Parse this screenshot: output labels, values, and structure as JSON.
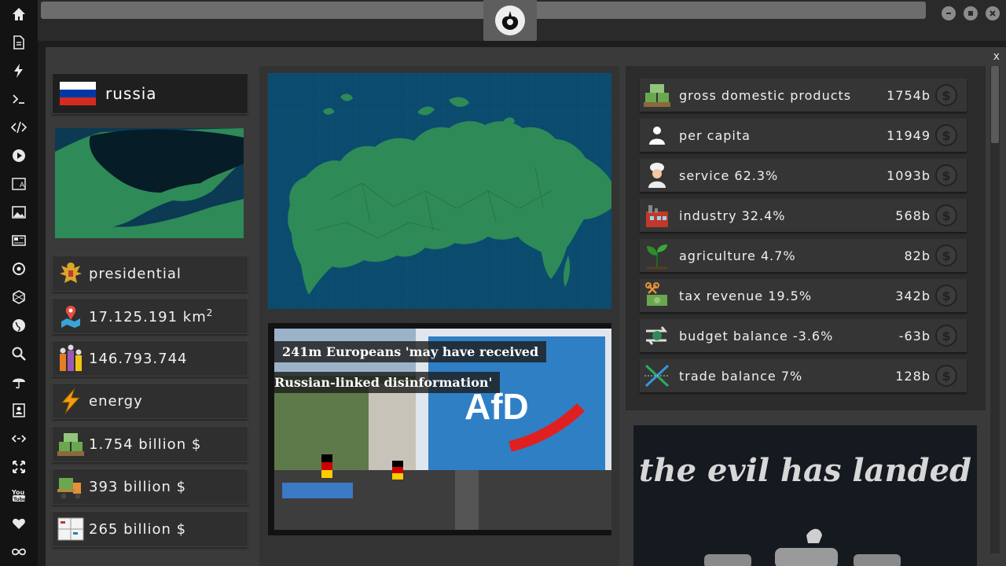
{
  "sidebar": {
    "icons": [
      "home-icon",
      "document-icon",
      "lightning-icon",
      "terminal-icon",
      "code-icon",
      "play-icon",
      "translate-icon",
      "image-icon",
      "newspaper-icon",
      "cog-icon",
      "polygon-icon",
      "globe-icon",
      "search-icon",
      "umbrella-icon",
      "contact-icon",
      "link-icon",
      "expand-icon",
      "youtube-icon",
      "heart-icon",
      "infinity-icon"
    ]
  },
  "window": {
    "close_label": "x"
  },
  "country": {
    "name": "russia",
    "flag_colors": [
      "#ffffff",
      "#0039a6",
      "#d52b1e"
    ]
  },
  "stats": {
    "government": "presidential",
    "area": "17.125.191 km",
    "area_unit_exp": "2",
    "population": "146.793.744",
    "resource": "energy",
    "gdp": "1.754 billion $",
    "value2": "393 billion $",
    "value3": "265 billion $"
  },
  "news": {
    "headline_line1": "241m Europeans 'may have received",
    "headline_line2": "Russian-linked disinformation'",
    "sign_text": "AfD"
  },
  "economy": [
    {
      "label": "gross domestic products",
      "value": "1754b",
      "icon": "money-pallet-icon"
    },
    {
      "label": "per capita",
      "value": "11949",
      "icon": "person-icon"
    },
    {
      "label": "service 62.3%",
      "value": "1093b",
      "icon": "chef-icon"
    },
    {
      "label": "industry 32.4%",
      "value": "568b",
      "icon": "factory-icon"
    },
    {
      "label": "agriculture 4.7%",
      "value": "82b",
      "icon": "plant-icon"
    },
    {
      "label": "tax revenue 19.5%",
      "value": "342b",
      "icon": "tax-icon"
    },
    {
      "label": "budget balance -3.6%",
      "value": "-63b",
      "icon": "balance-arrows-icon"
    },
    {
      "label": "trade balance 7%",
      "value": "128b",
      "icon": "trade-cross-icon"
    }
  ],
  "currency_symbol": "$",
  "poster": {
    "title": "the evil has landed"
  },
  "colors": {
    "map_land": "#2e8a57",
    "map_sea": "#0b4b6e",
    "accent_dark": "#1f1f1f"
  }
}
